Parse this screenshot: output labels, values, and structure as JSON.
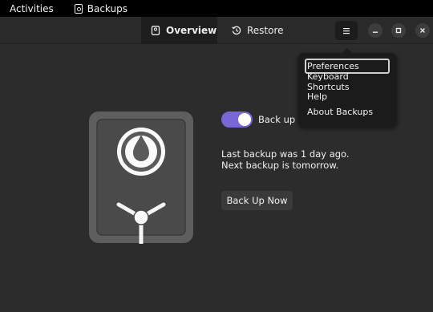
{
  "topbar": {
    "activities": "Activities",
    "app_name": "Backups",
    "app_icon": "vault-icon"
  },
  "header": {
    "tabs": [
      {
        "label": "Overview",
        "icon": "vault-icon",
        "active": true
      },
      {
        "label": "Restore",
        "icon": "history-icon",
        "active": false
      }
    ],
    "menu_icon": "hamburger-icon",
    "window_controls": [
      "minimize-icon",
      "maximize-icon",
      "close-icon"
    ]
  },
  "menu": {
    "items": [
      {
        "label": "Preferences",
        "selected": true
      },
      {
        "label": "Keyboard Shortcuts",
        "selected": false
      },
      {
        "label": "Help",
        "selected": false
      },
      {
        "label": "About Backups",
        "selected": false
      }
    ]
  },
  "overview": {
    "toggle_label": "Back up a",
    "toggle_on": true,
    "status_line1": "Last backup was 1 day ago.",
    "status_line2": "Next backup is tomorrow.",
    "backup_button": "Back Up Now"
  },
  "colors": {
    "accent": "#7a67d6",
    "window_bg": "#2c2c2c",
    "header_bg": "#2a2a2a",
    "popover_bg": "#1b1b1b"
  }
}
